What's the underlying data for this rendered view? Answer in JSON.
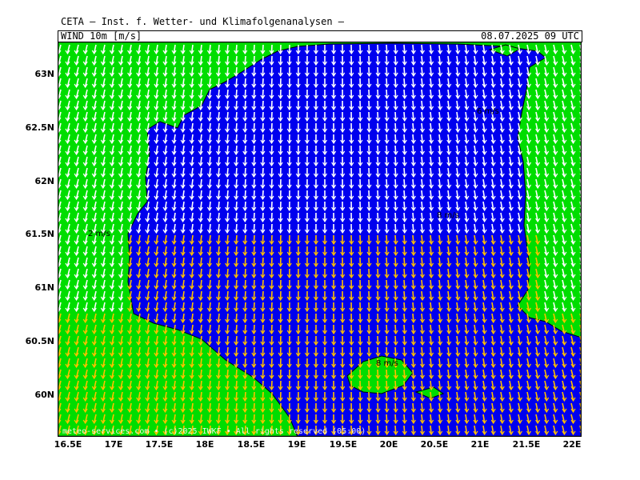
{
  "header": {
    "organization": "CETA — Inst. f. Wetter- und Klimafolgenanalysen —",
    "parameter": "WIND 10m [m/s]",
    "valid_time": "08.07.2025 09 UTC"
  },
  "axes": {
    "lat_labels": [
      "63N",
      "62.5N",
      "62N",
      "61.5N",
      "61N",
      "60.5N",
      "60N"
    ],
    "lon_labels": [
      "16.5E",
      "17E",
      "17.5E",
      "18E",
      "18.5E",
      "19E",
      "19.5E",
      "20E",
      "20.5E",
      "21E",
      "21.5E",
      "22E"
    ]
  },
  "annotations": {
    "speed_west": "2 m/s",
    "speed_center": "8 m/s",
    "speed_northeast": "6 m/s",
    "speed_south": "8 m/s"
  },
  "credit": "meteo-services.com • (c)2025 IWKF • All rights reserved (05:00)",
  "colors": {
    "land": "#00dd00",
    "sea": "#0000ee",
    "vector_light": "#ffffff",
    "vector_strong": "#ffc000"
  }
}
